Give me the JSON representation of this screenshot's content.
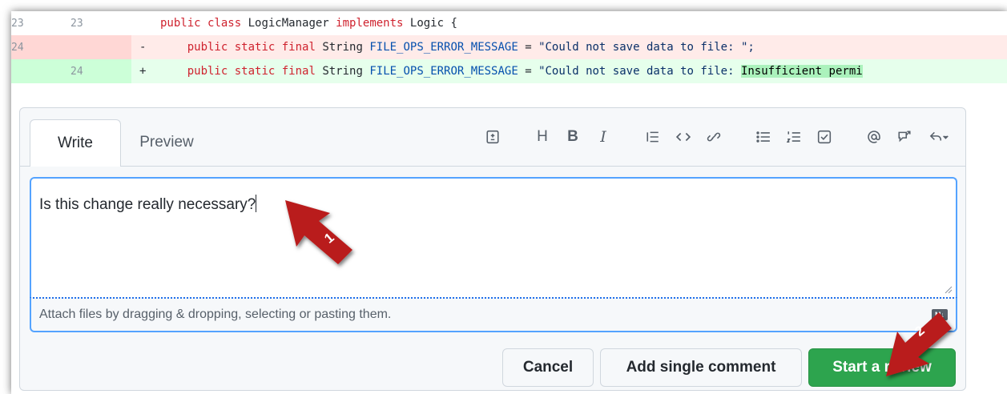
{
  "diff": {
    "rows": [
      {
        "type": "context",
        "old_ln": "23",
        "new_ln": "23",
        "sign": "",
        "parts": [
          [
            "kw",
            "public "
          ],
          [
            "kw",
            "class "
          ],
          [
            "ty",
            "LogicManager "
          ],
          [
            "kw",
            "implements "
          ],
          [
            "ty",
            "Logic {"
          ]
        ]
      },
      {
        "type": "deletion",
        "old_ln": "24",
        "new_ln": "",
        "sign": "-",
        "parts": [
          [
            "kw",
            "public "
          ],
          [
            "kw",
            "static "
          ],
          [
            "kw",
            "final "
          ],
          [
            "ty",
            "String "
          ],
          [
            "id",
            "FILE_OPS_ERROR_MESSAGE"
          ],
          [
            "ty",
            " = "
          ],
          [
            "str",
            "\"Could not save data to file: \";"
          ]
        ]
      },
      {
        "type": "addition",
        "old_ln": "",
        "new_ln": "24",
        "sign": "+",
        "parts": [
          [
            "kw",
            "public "
          ],
          [
            "kw",
            "static "
          ],
          [
            "kw",
            "final "
          ],
          [
            "ty",
            "String "
          ],
          [
            "id",
            "FILE_OPS_ERROR_MESSAGE"
          ],
          [
            "ty",
            " = "
          ],
          [
            "str",
            "\"Could not save data to file: "
          ],
          [
            "hl",
            "Insufficient permi"
          ]
        ]
      }
    ]
  },
  "comment": {
    "tabs": [
      {
        "label": "Write"
      },
      {
        "label": "Preview"
      }
    ],
    "toolbar_text": {
      "heading": "H",
      "bold": "B",
      "italic": "I"
    },
    "editor_text": "Is this change really necessary?",
    "attach_text": "Attach files by dragging & dropping, selecting or pasting them.",
    "markdown_badge": "M↓"
  },
  "buttons": {
    "cancel": "Cancel",
    "single": "Add single comment",
    "review": "Start a review"
  },
  "annotations": {
    "arrow1": "1",
    "arrow2": "2",
    "color": "#b91c1c"
  }
}
